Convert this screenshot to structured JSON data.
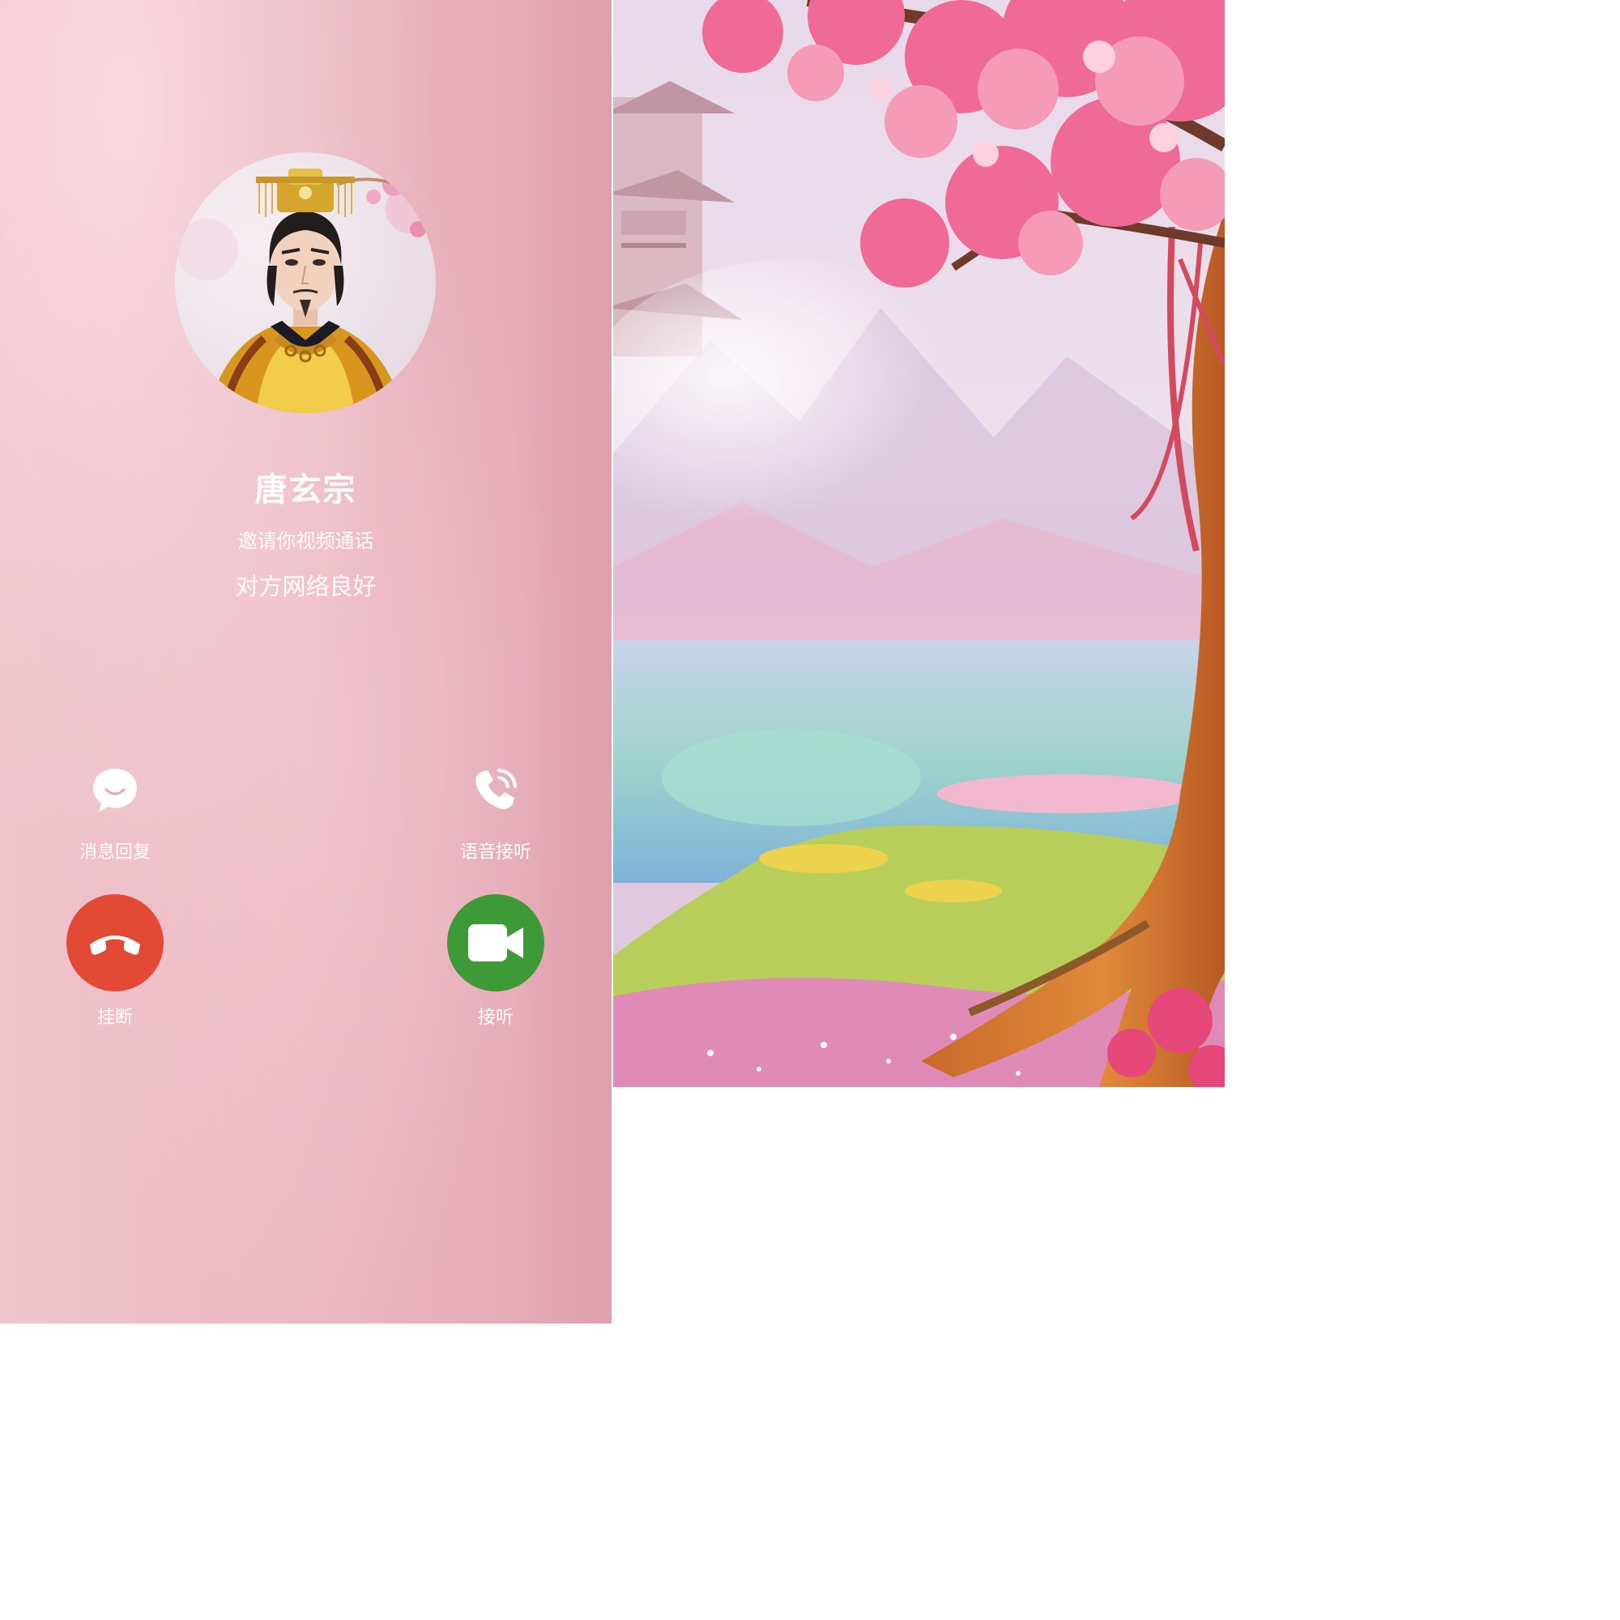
{
  "caller": {
    "name": "唐玄宗",
    "subtitle": "邀请你视频通话",
    "network_status": "对方网络良好"
  },
  "actions": {
    "message_reply_label": "消息回复",
    "voice_answer_label": "语音接听",
    "hangup_label": "挂断",
    "answer_label": "接听"
  },
  "icons": {
    "message_reply": "chat-bubble-icon",
    "voice_answer": "phone-ringing-icon",
    "hangup": "phone-hangup-icon",
    "answer": "video-camera-icon"
  },
  "colors": {
    "hangup_button": "#e24a35",
    "answer_button": "#3d9a36",
    "background": "#ebb8c3",
    "text": "#ffffff"
  }
}
